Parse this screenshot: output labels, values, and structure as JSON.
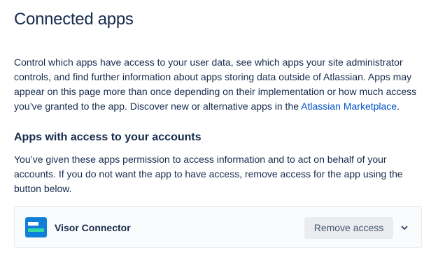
{
  "page": {
    "title": "Connected apps"
  },
  "intro": {
    "text": "Control which apps have access to your user data, see which apps your site administrator controls, and find further information about apps storing data outside of Atlassian. Apps may appear on this page more than once depending on their implementation or how much access you’ve granted to the app. Discover new or alternative apps in the ",
    "link_text": "Atlassian Marketplace",
    "suffix": "."
  },
  "section": {
    "heading": "Apps with access to your accounts",
    "description": "You’ve given these apps permission to access information and to act on behalf of your accounts. If you do not want the app to have access, remove access for the app using the button below."
  },
  "apps": [
    {
      "name": "Visor Connector",
      "action_label": "Remove access",
      "logo_icon": "visor-logo-icon",
      "expand_icon": "chevron-down-icon"
    }
  ],
  "colors": {
    "text": "#172b4d",
    "link": "#0052cc",
    "button_bg": "#ebecf0",
    "button_text": "#42526e",
    "card_bg": "#fafbfc",
    "logo_blue": "#0f7fd8",
    "logo_green": "#36d9a0"
  }
}
